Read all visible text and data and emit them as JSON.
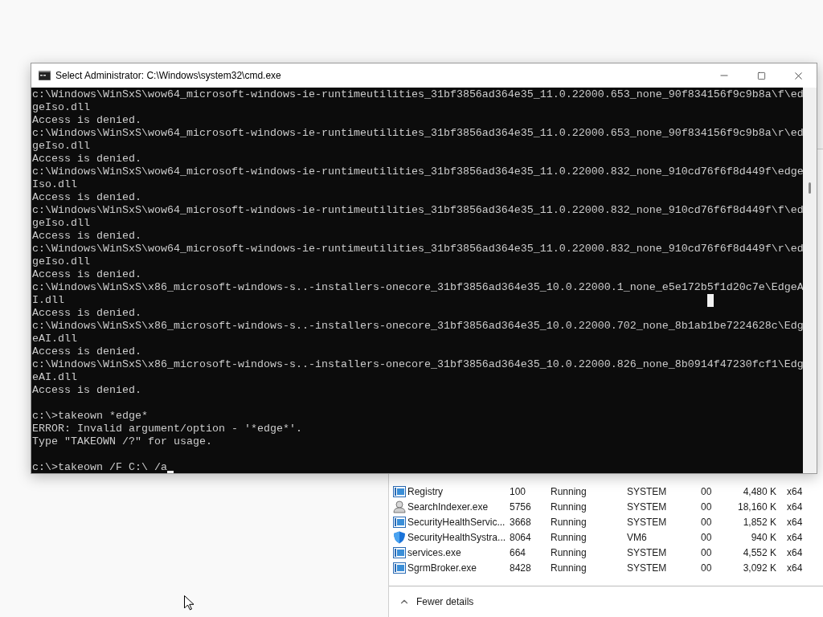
{
  "console_window": {
    "title": "Select Administrator: C:\\Windows\\system32\\cmd.exe",
    "blocks": [
      [
        "c:\\Windows\\WinSxS\\wow64_microsoft-windows-ie-runtimeutilities_31bf3856ad364e35_11.0.22000.653_none_90f834156f9c9b8a\\f\\ed",
        "geIso.dll",
        "Access is denied.",
        "c:\\Windows\\WinSxS\\wow64_microsoft-windows-ie-runtimeutilities_31bf3856ad364e35_11.0.22000.653_none_90f834156f9c9b8a\\r\\ed",
        "geIso.dll",
        "Access is denied.",
        "c:\\Windows\\WinSxS\\wow64_microsoft-windows-ie-runtimeutilities_31bf3856ad364e35_11.0.22000.832_none_910cd76f6f8d449f\\edge",
        "Iso.dll",
        "Access is denied.",
        "c:\\Windows\\WinSxS\\wow64_microsoft-windows-ie-runtimeutilities_31bf3856ad364e35_11.0.22000.832_none_910cd76f6f8d449f\\f\\ed",
        "geIso.dll",
        "Access is denied.",
        "c:\\Windows\\WinSxS\\wow64_microsoft-windows-ie-runtimeutilities_31bf3856ad364e35_11.0.22000.832_none_910cd76f6f8d449f\\r\\ed",
        "geIso.dll",
        "Access is denied.",
        "c:\\Windows\\WinSxS\\x86_microsoft-windows-s..-installers-onecore_31bf3856ad364e35_10.0.22000.1_none_e5e172b5f1d20c7e\\EdgeA",
        "I.dll",
        "Access is denied.",
        "c:\\Windows\\WinSxS\\x86_microsoft-windows-s..-installers-onecore_31bf3856ad364e35_10.0.22000.702_none_8b1ab1be7224628c\\Edg",
        "eAI.dll",
        "Access is denied.",
        "c:\\Windows\\WinSxS\\x86_microsoft-windows-s..-installers-onecore_31bf3856ad364e35_10.0.22000.826_none_8b0914f47230fcf1\\Edg",
        "eAI.dll",
        "Access is denied."
      ],
      [
        "c:\\>takeown *edge*",
        "ERROR: Invalid argument/option - '*edge*'.",
        "Type \"TAKEOWN /?\" for usage."
      ]
    ],
    "prompt": "c:\\>takeown /F C:\\ /a"
  },
  "task_manager": {
    "processes": [
      {
        "kind": "window",
        "name": "Registry",
        "pid": "100",
        "status": "Running",
        "user": "SYSTEM",
        "cpu": "00",
        "memory": "4,480 K",
        "arch": "x64"
      },
      {
        "kind": "person",
        "name": "SearchIndexer.exe",
        "pid": "5756",
        "status": "Running",
        "user": "SYSTEM",
        "cpu": "00",
        "memory": "18,160 K",
        "arch": "x64"
      },
      {
        "kind": "window",
        "name": "SecurityHealthServic...",
        "pid": "3668",
        "status": "Running",
        "user": "SYSTEM",
        "cpu": "00",
        "memory": "1,852 K",
        "arch": "x64"
      },
      {
        "kind": "shield",
        "name": "SecurityHealthSystra...",
        "pid": "8064",
        "status": "Running",
        "user": "VM6",
        "cpu": "00",
        "memory": "940 K",
        "arch": "x64"
      },
      {
        "kind": "window",
        "name": "services.exe",
        "pid": "664",
        "status": "Running",
        "user": "SYSTEM",
        "cpu": "00",
        "memory": "4,552 K",
        "arch": "x64"
      },
      {
        "kind": "window",
        "name": "SgrmBroker.exe",
        "pid": "8428",
        "status": "Running",
        "user": "SYSTEM",
        "cpu": "00",
        "memory": "3,092 K",
        "arch": "x64"
      }
    ],
    "footer": "Fewer details"
  }
}
